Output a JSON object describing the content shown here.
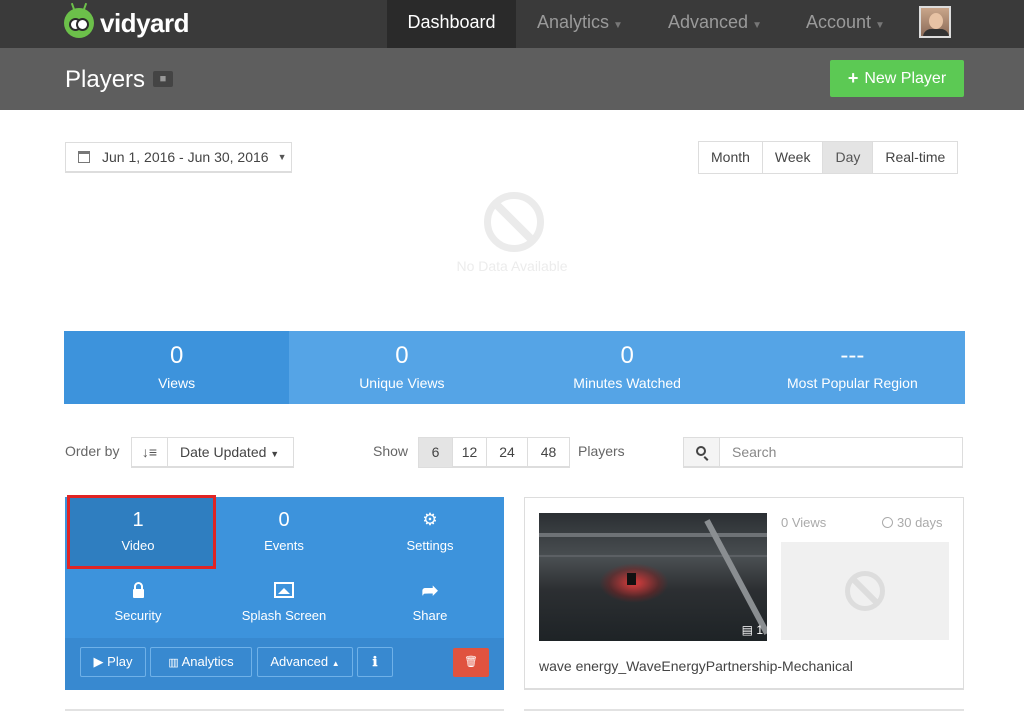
{
  "app": {
    "logo_text": "vidyard"
  },
  "nav": {
    "dashboard": "Dashboard",
    "analytics": "Analytics",
    "advanced": "Advanced",
    "account": "Account"
  },
  "header": {
    "title": "Players",
    "new_player_label": "New Player"
  },
  "date_range": {
    "label": "Jun 1, 2016 - Jun 30, 2016"
  },
  "granularity": {
    "options": [
      "Month",
      "Week",
      "Day",
      "Real-time"
    ],
    "selected": "Day"
  },
  "no_data": {
    "text": "No Data Available"
  },
  "stats": [
    {
      "value": "0",
      "label": "Views",
      "color": "#3d93dc"
    },
    {
      "value": "0",
      "label": "Unique Views",
      "color": "#55a4e6"
    },
    {
      "value": "0",
      "label": "Minutes Watched",
      "color": "#55a4e6"
    },
    {
      "value": "---",
      "label": "Most Popular Region",
      "color": "#55a4e6"
    }
  ],
  "controls": {
    "order_by_label": "Order by",
    "order_by_value": "Date Updated",
    "show_label": "Show",
    "show_options": [
      "6",
      "12",
      "24",
      "48"
    ],
    "show_selected": "6",
    "players_label": "Players",
    "search_placeholder": "Search"
  },
  "player_card": {
    "video_count": "1",
    "video_label": "Video",
    "events_count": "0",
    "events_label": "Events",
    "settings_label": "Settings",
    "security_label": "Security",
    "splash_label": "Splash Screen",
    "share_label": "Share",
    "play_label": "Play",
    "analytics_label": "Analytics",
    "advanced_label": "Advanced"
  },
  "video_card": {
    "views": "0 Views",
    "period": "30 days",
    "video_count": "1",
    "title": "wave energy_WaveEnergyPartnership-Mechanical"
  },
  "colors": {
    "accent": "#3d93dc",
    "new_player": "#5cc954",
    "delete": "#e0533f",
    "highlight": "#e02424"
  }
}
